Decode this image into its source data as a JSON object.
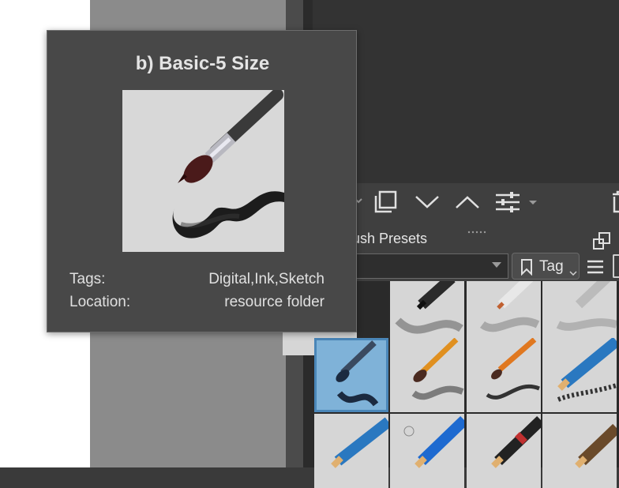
{
  "tooltip": {
    "title": "b) Basic-5 Size",
    "tags_label": "Tags:",
    "tags_value": "Digital,Ink,Sketch",
    "location_label": "Location:",
    "location_value": "resource folder"
  },
  "docker": {
    "title": "ush Presets",
    "tag_button_label": "Tag",
    "search_value": ""
  },
  "toolbar": {
    "icons": [
      "save-icon",
      "move-down-icon",
      "move-up-icon",
      "settings-icon",
      "delete-icon"
    ]
  },
  "presets": {
    "selected": "b) Basic-5 Size",
    "colors": {
      "selected_bg": "#7fb2d8",
      "cell_bg": "#d6d6d6"
    }
  }
}
